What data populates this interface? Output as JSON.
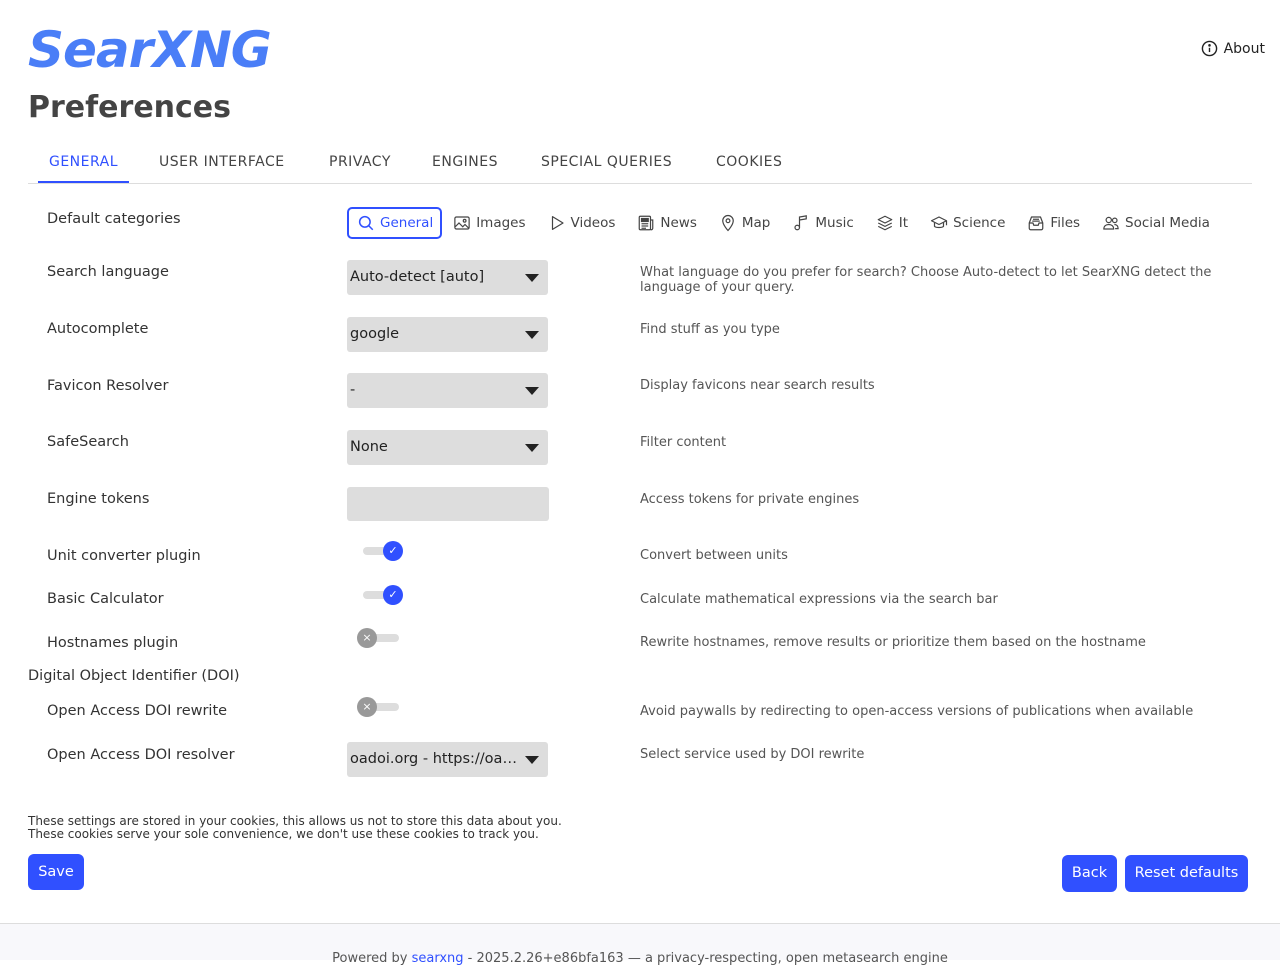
{
  "app": {
    "logo": "SearXNG",
    "about_label": "About"
  },
  "page_title": "Preferences",
  "tabs": [
    {
      "label": "GENERAL",
      "active": true
    },
    {
      "label": "USER INTERFACE"
    },
    {
      "label": "PRIVACY"
    },
    {
      "label": "ENGINES"
    },
    {
      "label": "SPECIAL QUERIES"
    },
    {
      "label": "COOKIES"
    }
  ],
  "categories": {
    "label": "Default categories",
    "items": [
      {
        "label": "General",
        "icon": "search-icon",
        "selected": true
      },
      {
        "label": "Images",
        "icon": "image-icon"
      },
      {
        "label": "Videos",
        "icon": "play-icon"
      },
      {
        "label": "News",
        "icon": "newspaper-icon"
      },
      {
        "label": "Map",
        "icon": "map-pin-icon"
      },
      {
        "label": "Music",
        "icon": "music-note-icon"
      },
      {
        "label": "It",
        "icon": "layers-icon"
      },
      {
        "label": "Science",
        "icon": "graduation-cap-icon"
      },
      {
        "label": "Files",
        "icon": "file-tray-icon"
      },
      {
        "label": "Social Media",
        "icon": "people-icon"
      }
    ]
  },
  "settings": {
    "search_language": {
      "label": "Search language",
      "value": "Auto-detect [auto]",
      "description": "What language do you prefer for search? Choose Auto-detect to let SearXNG detect the language of your query."
    },
    "autocomplete": {
      "label": "Autocomplete",
      "value": "google",
      "description": "Find stuff as you type"
    },
    "favicon_resolver": {
      "label": "Favicon Resolver",
      "value": "-",
      "description": "Display favicons near search results"
    },
    "safesearch": {
      "label": "SafeSearch",
      "value": "None",
      "description": "Filter content"
    },
    "engine_tokens": {
      "label": "Engine tokens",
      "value": "",
      "description": "Access tokens for private engines"
    },
    "unit_converter": {
      "label": "Unit converter plugin",
      "enabled": true,
      "description": "Convert between units"
    },
    "basic_calculator": {
      "label": "Basic Calculator",
      "enabled": true,
      "description": "Calculate mathematical expressions via the search bar"
    },
    "hostnames": {
      "label": "Hostnames plugin",
      "enabled": false,
      "description": "Rewrite hostnames, remove results or prioritize them based on the hostname"
    },
    "doi_group_title": "Digital Object Identifier (DOI)",
    "doi_rewrite": {
      "label": "Open Access DOI rewrite",
      "enabled": false,
      "description": "Avoid paywalls by redirecting to open-access versions of publications when available"
    },
    "doi_resolver": {
      "label": "Open Access DOI resolver",
      "value": "oadoi.org - https://oadoi.org/",
      "description": "Select service used by DOI rewrite"
    }
  },
  "cookie_note": {
    "line1": "These settings are stored in your cookies, this allows us not to store this data about you.",
    "line2": "These cookies serve your sole convenience, we don't use these cookies to track you."
  },
  "buttons": {
    "save": "Save",
    "back": "Back",
    "reset": "Reset defaults"
  },
  "footer": {
    "prefix": "Powered by",
    "link": "searxng",
    "suffix": "- 2025.2.26+e86bfa163 — a privacy-respecting, open metasearch engine"
  },
  "colors": {
    "accent": "#3050ff",
    "logo": "#4a7ef7"
  }
}
